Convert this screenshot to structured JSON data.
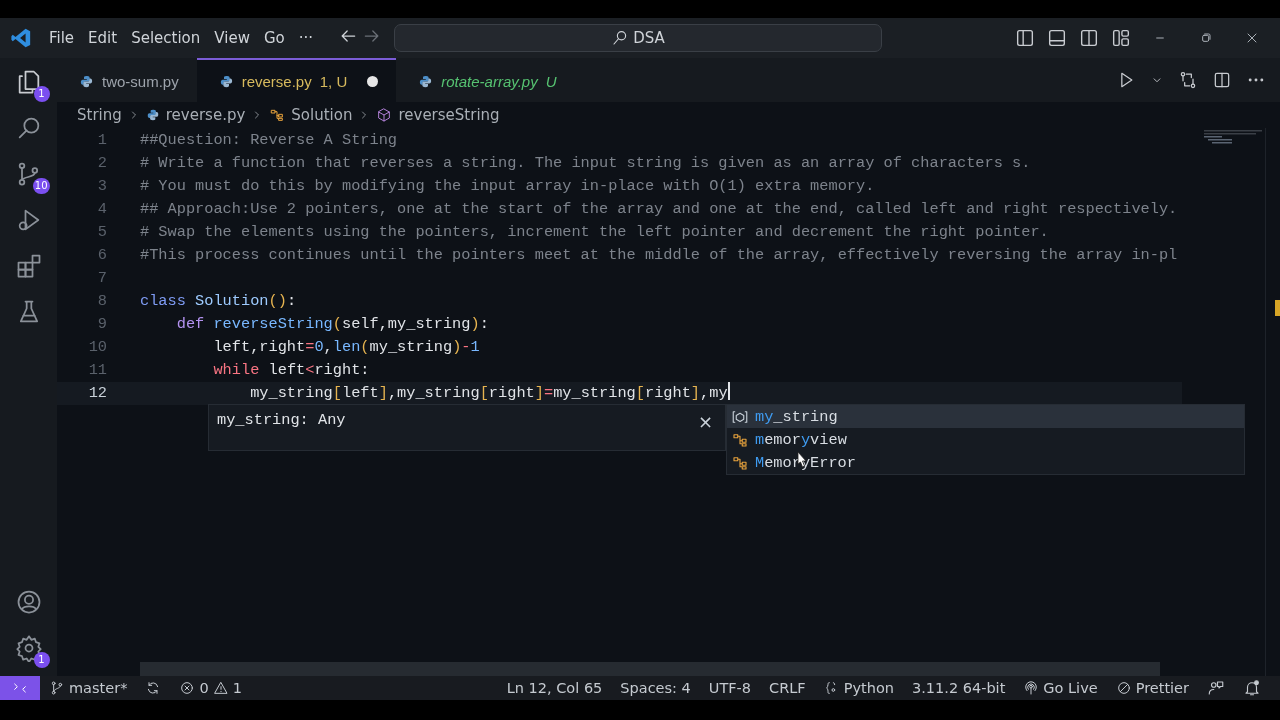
{
  "title_bar": {
    "menus": [
      "File",
      "Edit",
      "Selection",
      "View",
      "Go"
    ],
    "more": "···",
    "search": "DSA"
  },
  "activity_bar": {
    "items": [
      {
        "kind": "explorer",
        "badge": "1"
      },
      {
        "kind": "search"
      },
      {
        "kind": "source-control",
        "badge": "10"
      },
      {
        "kind": "debug"
      },
      {
        "kind": "extensions"
      },
      {
        "kind": "testing"
      }
    ],
    "bottom": [
      {
        "kind": "account"
      },
      {
        "kind": "settings",
        "badge": "1"
      }
    ]
  },
  "tabs": [
    {
      "label": "two-sum.py",
      "selected": false,
      "kind": "normal",
      "preview": false,
      "modified": false
    },
    {
      "label": "reverse.py",
      "status": "1, U",
      "selected": true,
      "kind": "warning",
      "preview": false,
      "modified": true
    },
    {
      "label": "rotate-array.py",
      "status": "U",
      "selected": false,
      "kind": "untracked",
      "preview": true,
      "modified": false
    }
  ],
  "breadcrumb": [
    {
      "kind": "folder",
      "label": "String"
    },
    {
      "kind": "python",
      "label": "reverse.py"
    },
    {
      "kind": "class",
      "label": "Solution"
    },
    {
      "kind": "method",
      "label": "reverseString"
    }
  ],
  "editor": {
    "lines": [
      {
        "number": "1",
        "current": false,
        "tokens": [
          {
            "kind": "comment",
            "text": "##Question: Reverse A String"
          }
        ]
      },
      {
        "number": "2",
        "current": false,
        "tokens": [
          {
            "kind": "comment",
            "text": "# Write a function that reverses a string. The input string is given as an array of characters s."
          }
        ]
      },
      {
        "number": "3",
        "current": false,
        "tokens": [
          {
            "kind": "comment",
            "text": "# You must do this by modifying the input array in-place with O(1) extra memory."
          }
        ]
      },
      {
        "number": "4",
        "current": false,
        "tokens": [
          {
            "kind": "comment",
            "text": "## Approach:Use 2 pointers, one at the start of the array and one at the end, called left and right respectively."
          }
        ]
      },
      {
        "number": "5",
        "current": false,
        "tokens": [
          {
            "kind": "comment",
            "text": "# Swap the elements using the pointers, increment the left pointer and decrement the right pointer."
          }
        ]
      },
      {
        "number": "6",
        "current": false,
        "tokens": [
          {
            "kind": "comment",
            "text": "#This process continues until the pointers meet at the middle of the array, effectively reversing the array in-pl"
          }
        ]
      },
      {
        "number": "7",
        "current": false
      },
      {
        "number": "8",
        "current": false,
        "tokens": [
          {
            "kind": "keyword",
            "text": "class "
          },
          {
            "kind": "type",
            "text": "Solution"
          },
          {
            "kind": "paren",
            "text": "()"
          },
          {
            "kind": "plain",
            "text": ":"
          }
        ]
      },
      {
        "number": "9",
        "current": false,
        "tokens": [
          {
            "kind": "def",
            "text": "    def "
          },
          {
            "kind": "func",
            "text": "reverseString"
          },
          {
            "kind": "paren",
            "text": "("
          },
          {
            "kind": "plain",
            "text": "self,my_string"
          },
          {
            "kind": "paren",
            "text": ")"
          },
          {
            "kind": "plain",
            "text": ":"
          }
        ]
      },
      {
        "number": "10",
        "current": false,
        "tokens": [
          {
            "kind": "plain",
            "text": "        left,right"
          },
          {
            "kind": "op",
            "text": "="
          },
          {
            "kind": "num",
            "text": "0"
          },
          {
            "kind": "plain",
            "text": ","
          },
          {
            "kind": "builtin",
            "text": "len"
          },
          {
            "kind": "paren",
            "text": "("
          },
          {
            "kind": "plain",
            "text": "my_string"
          },
          {
            "kind": "paren",
            "text": ")"
          },
          {
            "kind": "op",
            "text": "-"
          },
          {
            "kind": "num",
            "text": "1"
          }
        ]
      },
      {
        "number": "11",
        "current": false,
        "tokens": [
          {
            "kind": "control",
            "text": "        while"
          },
          {
            "kind": "plain",
            "text": " left"
          },
          {
            "kind": "op",
            "text": "<"
          },
          {
            "kind": "plain",
            "text": "right:"
          }
        ]
      },
      {
        "number": "12",
        "current": true,
        "tokens": [
          {
            "kind": "plain",
            "text": "            my_string"
          },
          {
            "kind": "paren",
            "text": "["
          },
          {
            "kind": "plain",
            "text": "left"
          },
          {
            "kind": "paren",
            "text": "]"
          },
          {
            "kind": "plain",
            "text": ",my_string"
          },
          {
            "kind": "paren",
            "text": "["
          },
          {
            "kind": "plain",
            "text": "right"
          },
          {
            "kind": "paren",
            "text": "]"
          },
          {
            "kind": "op",
            "text": "="
          },
          {
            "kind": "plain",
            "text": "my_string"
          },
          {
            "kind": "paren",
            "text": "["
          },
          {
            "kind": "plain",
            "text": "right"
          },
          {
            "kind": "paren",
            "text": "]"
          },
          {
            "kind": "plain",
            "text": ",my"
          }
        ]
      }
    ],
    "hover": {
      "text": "my_string: Any",
      "close": "×"
    },
    "suggestions": [
      {
        "kind": "variable",
        "selected": true,
        "parts": [
          {
            "text": "my",
            "match": true
          },
          {
            "text": "_string",
            "match": false
          }
        ]
      },
      {
        "kind": "class",
        "selected": false,
        "parts": [
          {
            "text": "m",
            "match": true
          },
          {
            "text": "emor",
            "match": false
          },
          {
            "text": "y",
            "match": true
          },
          {
            "text": "view",
            "match": false
          }
        ]
      },
      {
        "kind": "class",
        "selected": false,
        "parts": [
          {
            "text": "M",
            "match": true
          },
          {
            "text": "emoryError",
            "match": false
          }
        ]
      }
    ]
  },
  "status_bar": {
    "branch": "master*",
    "errors": "0",
    "warnings": "1",
    "right": [
      {
        "kind": "text",
        "label": "Ln 12, Col 65"
      },
      {
        "kind": "text",
        "label": "Spaces: 4"
      },
      {
        "kind": "text",
        "label": "UTF-8"
      },
      {
        "kind": "text",
        "label": "CRLF"
      },
      {
        "kind": "language",
        "label": "Python"
      },
      {
        "kind": "text",
        "label": "3.11.2 64-bit"
      },
      {
        "kind": "live",
        "label": "Go Live"
      },
      {
        "kind": "prettier",
        "label": "Prettier"
      }
    ]
  }
}
